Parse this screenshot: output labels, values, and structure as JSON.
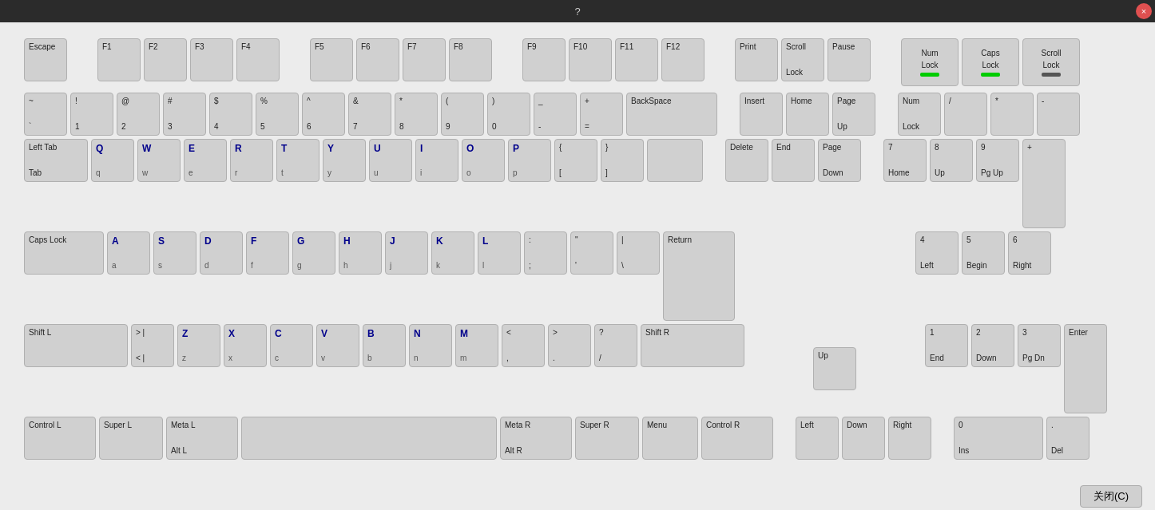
{
  "titleBar": {
    "title": "?",
    "closeBtn": "×"
  },
  "keyboard": {
    "rows": {
      "functionRow": {
        "keys": [
          {
            "id": "escape",
            "line1": "Escape",
            "line2": ""
          },
          {
            "id": "f1",
            "line1": "F1",
            "line2": ""
          },
          {
            "id": "f2",
            "line1": "F2",
            "line2": ""
          },
          {
            "id": "f3",
            "line1": "F3",
            "line2": ""
          },
          {
            "id": "f4",
            "line1": "F4",
            "line2": ""
          },
          {
            "id": "f5",
            "line1": "F5",
            "line2": ""
          },
          {
            "id": "f6",
            "line1": "F6",
            "line2": ""
          },
          {
            "id": "f7",
            "line1": "F7",
            "line2": ""
          },
          {
            "id": "f8",
            "line1": "F8",
            "line2": ""
          },
          {
            "id": "f9",
            "line1": "F9",
            "line2": ""
          },
          {
            "id": "f10",
            "line1": "F10",
            "line2": ""
          },
          {
            "id": "f11",
            "line1": "F11",
            "line2": ""
          },
          {
            "id": "f12",
            "line1": "F12",
            "line2": ""
          },
          {
            "id": "print",
            "line1": "Print",
            "line2": ""
          },
          {
            "id": "scroll-lock",
            "line1": "Scroll",
            "line2": "Lock"
          },
          {
            "id": "pause",
            "line1": "Pause",
            "line2": ""
          }
        ]
      }
    },
    "indicators": [
      {
        "id": "num-lock",
        "line1": "Num",
        "line2": "Lock",
        "led": "green"
      },
      {
        "id": "caps-lock-ind",
        "line1": "Caps",
        "line2": "Lock",
        "led": "green"
      },
      {
        "id": "scroll-lock-ind",
        "line1": "Scroll",
        "line2": "Lock",
        "led": "dark"
      }
    ]
  },
  "bottomBar": {
    "closeBtn": "关闭(C)"
  }
}
